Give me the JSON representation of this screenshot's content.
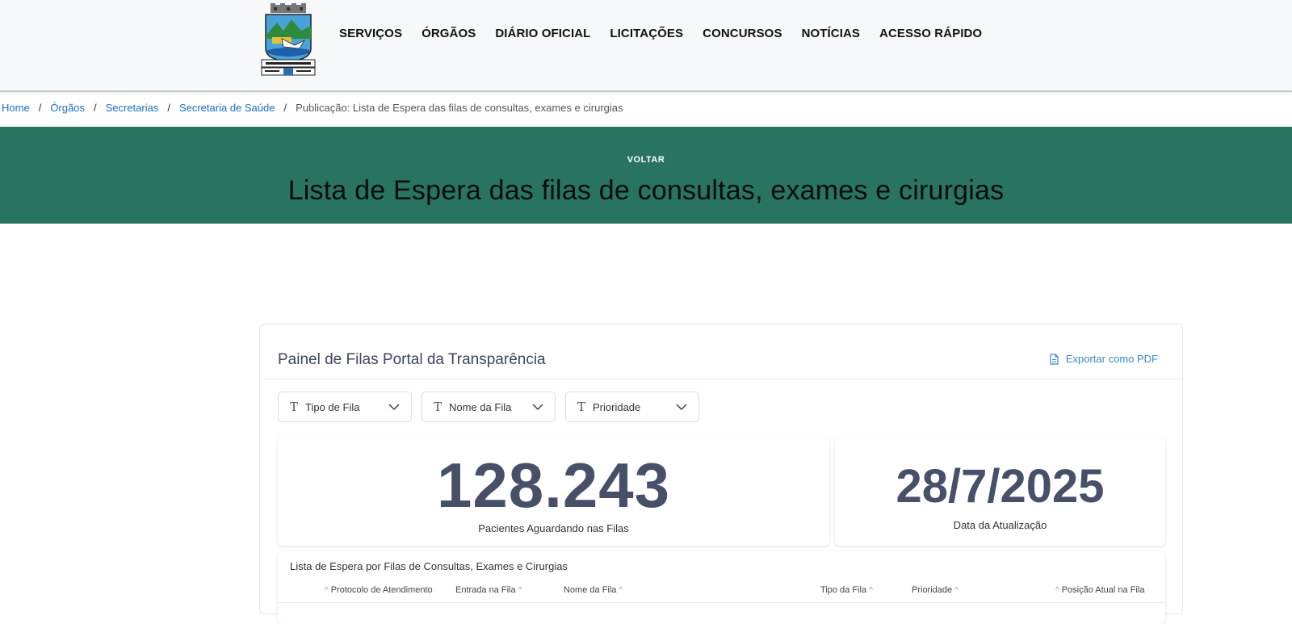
{
  "header": {
    "logo_icon": "city-coat-of-arms",
    "nav": [
      "SERVIÇOS",
      "ÓRGÃOS",
      "DIÁRIO OFICIAL",
      "LICITAÇÕES",
      "CONCURSOS",
      "NOTÍCIAS",
      "ACESSO RÁPIDO"
    ]
  },
  "breadcrumb": {
    "items": [
      "Home",
      "Órgãos",
      "Secretarias",
      "Secretaria de Saúde"
    ],
    "current": "Publicação: Lista de Espera das filas de consultas, exames e cirurgias",
    "separator": "/"
  },
  "banner": {
    "back_label": "VOLTAR",
    "title": "Lista de Espera das filas de consultas, exames e cirurgias",
    "background": "#287461"
  },
  "panel": {
    "title": "Painel de Filas Portal da Transparência",
    "export_label": "Exportar como PDF",
    "filters": [
      "Tipo de Fila",
      "Nome da Fila",
      "Prioridade"
    ],
    "kpis": {
      "waiting_count": "128.243",
      "waiting_caption": "Pacientes Aguardando nas Filas",
      "update_date": "28/7/2025",
      "update_caption": "Data da Atualização"
    },
    "table": {
      "title": "Lista de Espera por Filas de Consultas, Exames e Cirurgias",
      "columns": [
        "Protocolo de Atendimento",
        "Entrada na Fila",
        "Nome da Fila",
        "Tipo da Fila",
        "Prioridade",
        "Posição Atual na Fila"
      ]
    }
  }
}
